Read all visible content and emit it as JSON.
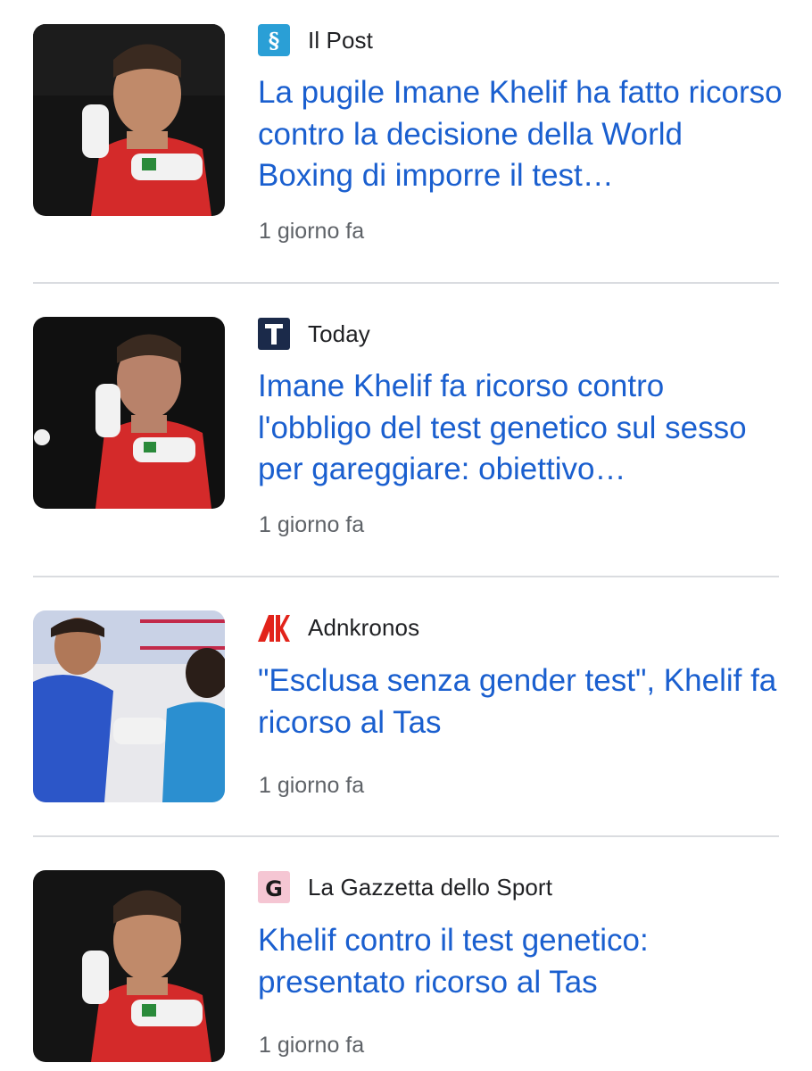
{
  "articles": [
    {
      "source": "Il Post",
      "source_icon": "il-post-logo-icon",
      "headline": "La pugile Imane Khelif ha fatto ricorso contro la decisione della World Boxing di imporre il test…",
      "time": "1 giorno fa"
    },
    {
      "source": "Today",
      "source_icon": "today-logo-icon",
      "headline": "Imane Khelif fa ricorso contro l'obbligo del test genetico sul sesso per gareggiare: obiettivo…",
      "time": "1 giorno fa"
    },
    {
      "source": "Adnkronos",
      "source_icon": "adnkronos-logo-icon",
      "headline": "\"Esclusa senza gender test\", Khelif fa ricorso al Tas",
      "time": "1 giorno fa"
    },
    {
      "source": "La Gazzetta dello Sport",
      "source_icon": "gazzetta-logo-icon",
      "headline": "Khelif contro il test genetico: presentato ricorso al Tas",
      "time": "1 giorno fa"
    }
  ],
  "colors": {
    "headline": "#1a5fcf",
    "source_text": "#202124",
    "time_text": "#5f6368",
    "divider": "#dadce0",
    "il_post_brand": "#2a9fd6",
    "today_brand": "#1b2a4a",
    "adnkronos_brand": "#e2231a",
    "gazzetta_brand": "#f5c6d3"
  }
}
